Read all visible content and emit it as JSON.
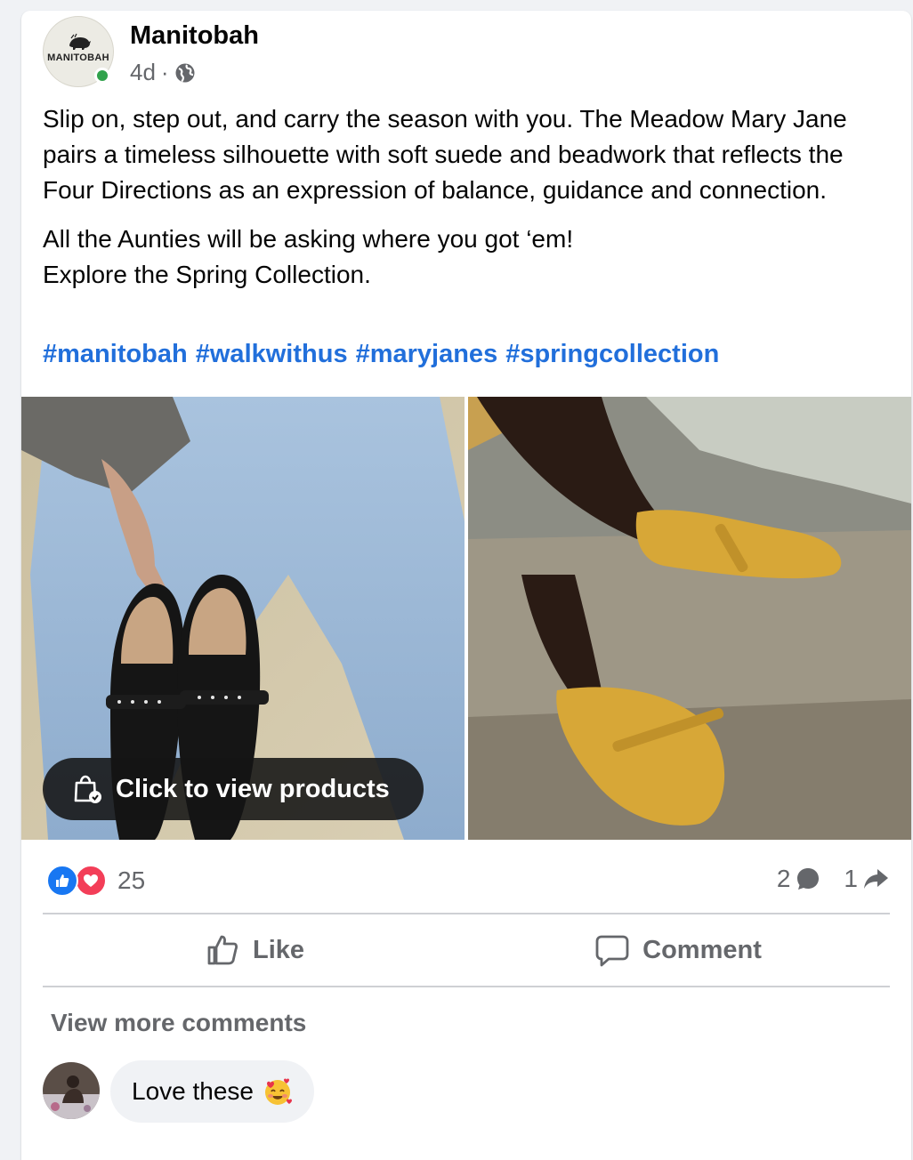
{
  "post": {
    "page_name": "Manitobah",
    "avatar_logo_text": "MANITOBAH",
    "time": "4d",
    "separator": "·",
    "audience_icon": "globe-icon",
    "text_paragraph_1": "Slip on, step out, and carry the season with you. The Meadow Mary Jane pairs a timeless silhouette with soft suede and beadwork that reflects the Four Directions as an expression of balance, guidance and connection.",
    "text_line_2": "All the Aunties will be asking where you got ‘em!",
    "text_line_3": "Explore the Spring Collection.",
    "hashtags": [
      "#manitobah",
      "#walkwithus",
      "#maryjanes",
      "#springcollection"
    ],
    "view_products_label": "Click to view products",
    "view_products_icon": "shopping-bag-icon"
  },
  "stats": {
    "reaction_icons": [
      "like-reaction-icon",
      "love-reaction-icon"
    ],
    "reaction_count": "25",
    "comment_count": "2",
    "share_count": "1"
  },
  "actions": {
    "like_label": "Like",
    "comment_label": "Comment"
  },
  "comments": {
    "view_more_label": "View more comments",
    "items": [
      {
        "text": "Love these",
        "emoji": "smiling-face-with-hearts"
      }
    ]
  },
  "colors": {
    "hashtag": "#216fdb",
    "secondary_text": "#65676b",
    "like_blue": "#1877f2",
    "love_red": "#f33e58",
    "online_green": "#31a24c"
  }
}
